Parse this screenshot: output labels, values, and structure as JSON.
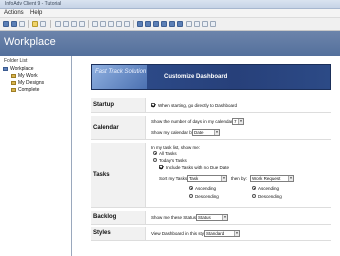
{
  "window": {
    "title": "InfoAdv Client 9 - Tutorial"
  },
  "menu": {
    "items": [
      "Actions",
      "Help"
    ]
  },
  "toolbar": {
    "icons": [
      "back-icon",
      "forward-icon",
      "refresh-icon",
      "home-icon",
      "search-icon"
    ]
  },
  "workplace": {
    "title": "Workplace"
  },
  "sidebar": {
    "header": "Folder List",
    "items": [
      {
        "label": "Workplace",
        "icon": "workplace-icon"
      },
      {
        "label": "My Work",
        "icon": "folder-icon"
      },
      {
        "label": "My Designs",
        "icon": "folder-icon"
      },
      {
        "label": "Complete",
        "icon": "folder-icon"
      }
    ]
  },
  "banner": {
    "logo_text": "Fast Track Solution",
    "title": "Customize Dashboard"
  },
  "startup": {
    "label": "Startup",
    "checkbox_label": "When starting, go directly to Dashboard",
    "checked": true
  },
  "calendar": {
    "label": "Calendar",
    "days_prefix": "Show the number of days in my calendar:",
    "days_value": "7",
    "show_prefix": "Show my calendar by:",
    "show_value": "Date"
  },
  "tasks": {
    "label": "Tasks",
    "intro": "In my task list, show me:",
    "radio_all": "All Tasks",
    "radio_today": "Today's Tasks",
    "include_label": "Include Tasks with no Due Date",
    "sort_prefix": "Sort my Tasks by:",
    "sort_value": "Task",
    "then_prefix": "then by:",
    "then_value": "Work Request",
    "asc1": "Ascending",
    "desc1": "Descending",
    "asc2": "Ascending",
    "desc2": "Descending"
  },
  "backlog": {
    "label": "Backlog",
    "prefix": "Show me these Status:",
    "value": "Status"
  },
  "styles": {
    "label": "Styles",
    "prefix": "View Dashboard in this style:",
    "value": "Standard"
  },
  "colors": {
    "accent": "#5d78a6",
    "banner": "#2f4f8f",
    "label_bg": "#f1f1f1"
  }
}
